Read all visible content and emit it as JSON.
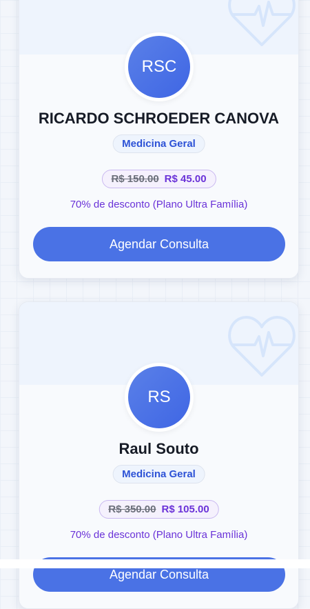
{
  "doctors": [
    {
      "initials": "RSC",
      "name": "RICARDO SCHROEDER CANOVA",
      "specialty": "Medicina Geral",
      "old_price": "R$ 150.00",
      "new_price": "R$ 45.00",
      "discount": "70% de desconto (Plano Ultra Família)",
      "button": "Agendar Consulta"
    },
    {
      "initials": "RS",
      "name": "Raul Souto",
      "specialty": "Medicina Geral",
      "old_price": "R$ 350.00",
      "new_price": "R$ 105.00",
      "discount": "70% de desconto (Plano Ultra Família)",
      "button": "Agendar Consulta"
    }
  ],
  "colors": {
    "accent": "#4a72e5",
    "discount": "#6a32d8",
    "specialty": "#2d52d6"
  },
  "icons": {
    "card_decoration": "heart-pulse-icon"
  }
}
